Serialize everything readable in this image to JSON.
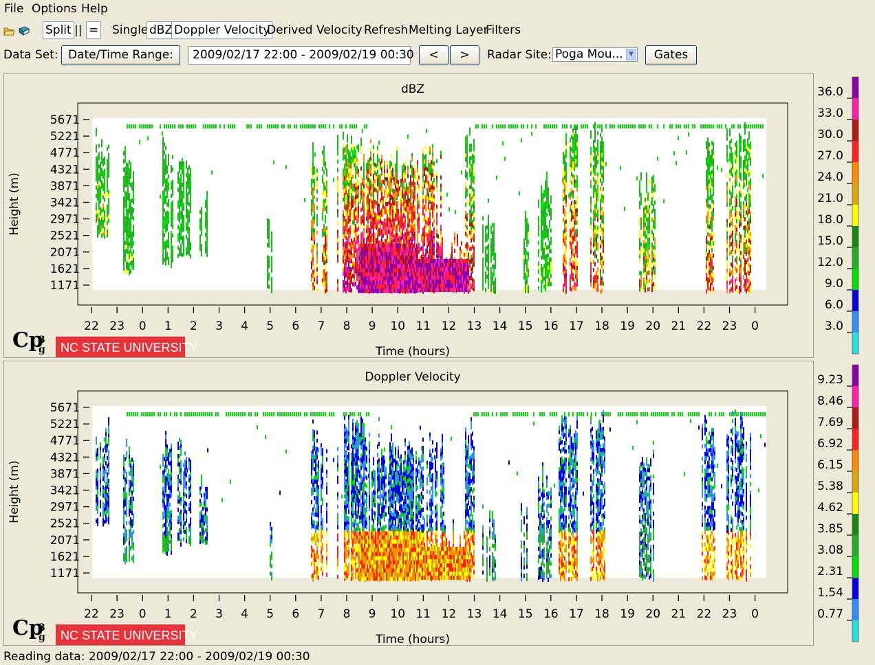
{
  "menu": {
    "file": "File",
    "options": "Options",
    "help": "Help"
  },
  "toolbar": {
    "split": "Split",
    "pause": "||",
    "equal": "=",
    "single": "Single",
    "dbz": "dBZ",
    "doppler": "Doppler Velocity",
    "derived": "Derived Velocity",
    "refresh": "Refresh",
    "melting": "Melting Layer",
    "filters": "Filters",
    "open_icon": "folder-open-icon",
    "book_icon": "book-icon"
  },
  "dataset": {
    "label": "Data Set:",
    "date_button": "Date/Time Range:",
    "range_value": "2009/02/17 22:00 - 2009/02/19 00:30",
    "prev": "<",
    "next": ">",
    "radar_label": "Radar Site:",
    "radar_value": "Poga Mou...",
    "gates": "Gates"
  },
  "panels": [
    {
      "title": "dBZ",
      "ylabel": "Height (m)",
      "xlabel": "Time (hours)",
      "yticks": [
        "5671",
        "5221",
        "4771",
        "4321",
        "3871",
        "3421",
        "2971",
        "2521",
        "2071",
        "1621",
        "1171"
      ],
      "xticks": [
        "22",
        "23",
        "0",
        "1",
        "2",
        "3",
        "4",
        "5",
        "6",
        "7",
        "8",
        "9",
        "10",
        "11",
        "12",
        "13",
        "14",
        "15",
        "16",
        "17",
        "18",
        "19",
        "20",
        "21",
        "22",
        "23",
        "0"
      ],
      "scale_labels": [
        "36.0",
        "33.0",
        "30.0",
        "27.0",
        "24.0",
        "21.0",
        "18.0",
        "15.0",
        "12.0",
        "9.0",
        "6.0",
        "3.0"
      ],
      "scale_colors": [
        "#8b00b0",
        "#ff1fb0",
        "#b01a10",
        "#ff2020",
        "#ff8c00",
        "#d8a800",
        "#ffff00",
        "#148a14",
        "#20b020",
        "#00e000",
        "#0000e0",
        "#2f8fff",
        "#20e0e0"
      ],
      "logo_text": "NC STATE UNIVERSITY",
      "logo_mark": "CP³"
    },
    {
      "title": "Doppler Velocity",
      "ylabel": "Height (m)",
      "xlabel": "Time (hours)",
      "yticks": [
        "5671",
        "5221",
        "4771",
        "4321",
        "3871",
        "3421",
        "2971",
        "2521",
        "2071",
        "1621",
        "1171"
      ],
      "xticks": [
        "22",
        "23",
        "0",
        "1",
        "2",
        "3",
        "4",
        "5",
        "6",
        "7",
        "8",
        "9",
        "10",
        "11",
        "12",
        "13",
        "14",
        "15",
        "16",
        "17",
        "18",
        "19",
        "20",
        "21",
        "22",
        "23",
        "0"
      ],
      "scale_labels": [
        "9.23",
        "8.46",
        "7.69",
        "6.92",
        "6.15",
        "5.38",
        "4.62",
        "3.85",
        "3.08",
        "2.31",
        "1.54",
        "0.77"
      ],
      "scale_colors": [
        "#8b00b0",
        "#ff1fb0",
        "#b01a10",
        "#ff2020",
        "#ff8c00",
        "#d8a800",
        "#ffff00",
        "#148a14",
        "#20b020",
        "#00e000",
        "#0000e0",
        "#2f8fff",
        "#20e0e0"
      ],
      "logo_text": "NC STATE UNIVERSITY",
      "logo_mark": "CP³"
    }
  ],
  "status": "Reading data: 2009/02/17 22:00 - 2009/02/19 00:30"
}
